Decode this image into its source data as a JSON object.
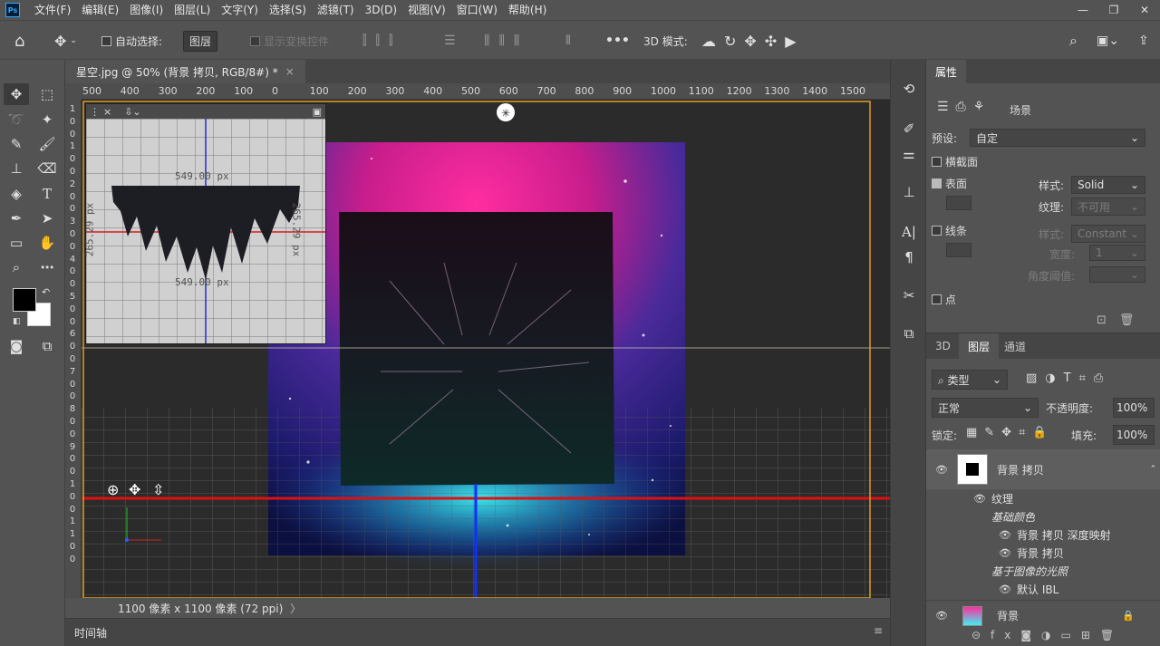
{
  "menu": [
    "文件(F)",
    "编辑(E)",
    "图像(I)",
    "图层(L)",
    "文字(Y)",
    "选择(S)",
    "滤镜(T)",
    "3D(D)",
    "视图(V)",
    "窗口(W)",
    "帮助(H)"
  ],
  "app_logo": "Ps",
  "options": {
    "auto_select_label": "自动选择:",
    "auto_select_value": "图层",
    "show_transform": "显示变换控件",
    "more": "•••",
    "mode_3d": "3D 模式:"
  },
  "document": {
    "tab_title": "星空.jpg @ 50% (背景 拷贝, RGB/8#) *",
    "tab_close": "×",
    "status": "1100 像素 x 1100 像素 (72 ppi)",
    "status_arrow": "〉"
  },
  "ruler": {
    "top": [
      "500",
      "400",
      "300",
      "200",
      "100",
      "0",
      "100",
      "200",
      "300",
      "400",
      "500",
      "600",
      "700",
      "800",
      "900",
      "1000",
      "1100",
      "1200",
      "1300",
      "1400",
      "1500"
    ],
    "left": [
      "1",
      "0",
      "0",
      "1",
      "0",
      "0",
      "2",
      "0",
      "0",
      "3",
      "0",
      "0",
      "4",
      "0",
      "0",
      "5",
      "0",
      "0",
      "6",
      "0",
      "0",
      "7",
      "0",
      "0",
      "8",
      "0",
      "0",
      "9",
      "0",
      "0",
      "1",
      "0",
      "0",
      "1",
      "1",
      "0",
      "0"
    ]
  },
  "secondary_view": {
    "close": "×",
    "dim_top": "549.00 px",
    "dim_bottom": "549.00 px",
    "dim_left": "265.29 px",
    "dim_right": "265.29 px"
  },
  "timeline": {
    "label": "时间轴",
    "menu": "≡"
  },
  "properties": {
    "tab": "属性",
    "scene_label": "场景",
    "preset_label": "预设:",
    "preset_value": "自定",
    "cross_section": "横截面",
    "surface": "表面",
    "surface_style_label": "样式:",
    "surface_style_value": "Solid",
    "texture_label": "纹理:",
    "texture_value": "不可用",
    "lines": "线条",
    "lines_style_label": "样式:",
    "lines_style_value": "Constant",
    "width_label": "宽度:",
    "width_value": "1",
    "angle_label": "角度阈值:",
    "points": "点"
  },
  "layers": {
    "tabs": [
      "3D",
      "图层",
      "通道"
    ],
    "filter_kind": "类型",
    "blend_mode": "正常",
    "opacity_label": "不透明度:",
    "opacity_value": "100%",
    "lock_label": "锁定:",
    "fill_label": "填充:",
    "fill_value": "100%",
    "items": [
      {
        "name": "背景 拷贝",
        "type": "layer3d"
      },
      {
        "name": "纹理",
        "type": "group"
      },
      {
        "name": "基础颜色",
        "type": "subhead"
      },
      {
        "name": "背景 拷贝 深度映射",
        "type": "texture"
      },
      {
        "name": "背景 拷贝",
        "type": "texture"
      },
      {
        "name": "基于图像的光照",
        "type": "subhead"
      },
      {
        "name": "默认 IBL",
        "type": "texture"
      },
      {
        "name": "背景",
        "type": "layer"
      }
    ]
  }
}
